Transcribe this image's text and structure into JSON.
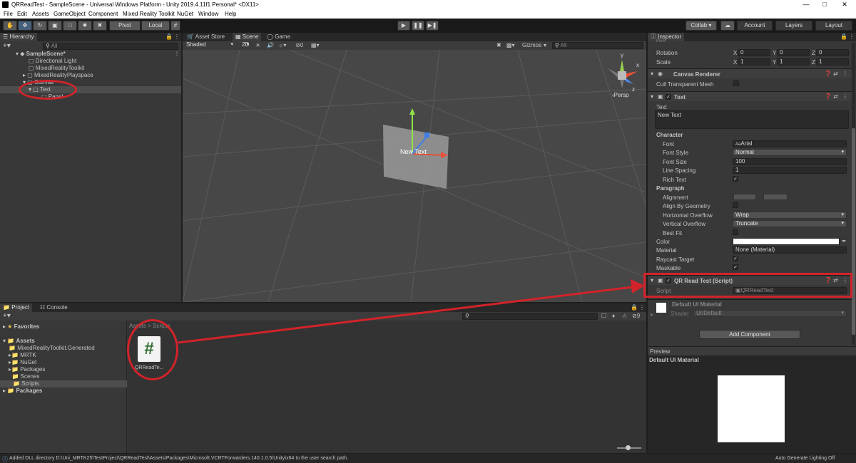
{
  "window": {
    "title": "QRReadTest - SampleScene - Universal Windows Platform - Unity 2019.4.11f1 Personal* <DX11>",
    "min": "—",
    "max": "□",
    "close": "✕"
  },
  "menu": [
    "File",
    "Edit",
    "Assets",
    "GameObject",
    "Component",
    "Mixed Reality Toolkit",
    "NuGet",
    "Window",
    "Help"
  ],
  "toolbar": {
    "pivot": "Pivot",
    "local": "Local",
    "collab": "Collab ▾",
    "account": "Account",
    "layers": "Layers",
    "layout": "Layout"
  },
  "hierarchy": {
    "tab": "Hierarchy",
    "search_placeholder": "All",
    "scene": "SampleScene*",
    "items": [
      {
        "label": "Directional Light"
      },
      {
        "label": "MixedRealityToolkit"
      },
      {
        "label": "MixedRealityPlayspace"
      },
      {
        "label": "Canvas"
      },
      {
        "label": "Text"
      },
      {
        "label": "Panel"
      }
    ]
  },
  "scene": {
    "tabs": [
      "Asset Store",
      "Scene",
      "Game"
    ],
    "shading": "Shaded",
    "mode2d": "2D",
    "fx_count": "0",
    "gizmos": "Gizmos",
    "search_placeholder": "All",
    "persp": "‹Persp",
    "gizmo_y": "y",
    "gizmo_x": "x",
    "gizmo_z": "z",
    "object_text": "New Text"
  },
  "project": {
    "tabs": [
      "Project",
      "Console"
    ],
    "favorites": "Favorites",
    "assets": "Assets",
    "asset_folders": [
      "MixedRealityToolkit.Generated",
      "MRTK",
      "NuGet",
      "Packages",
      "Scenes",
      "Scripts"
    ],
    "packages": "Packages",
    "breadcrumb": "Assets > Scripts",
    "file_name": "QRReadTe...",
    "file_glyph": "#",
    "hidden_count": "9"
  },
  "inspector": {
    "tab": "Inspector",
    "pivot_label": "Pivot",
    "rotation": {
      "label": "Rotation",
      "x": "0",
      "y": "0",
      "z": "0"
    },
    "scale": {
      "label": "Scale",
      "x": "1",
      "y": "1",
      "z": "1"
    },
    "canvas_renderer": "Canvas Renderer",
    "cull": "Cull Transparent Mesh",
    "text_comp": "Text",
    "text_label": "Text",
    "text_value": "New Text",
    "character": "Character",
    "font": {
      "label": "Font",
      "value": "Arial"
    },
    "font_style": {
      "label": "Font Style",
      "value": "Normal"
    },
    "font_size": {
      "label": "Font Size",
      "value": "100"
    },
    "line_spacing": {
      "label": "Line Spacing",
      "value": "1"
    },
    "rich_text": "Rich Text",
    "paragraph": "Paragraph",
    "alignment": "Alignment",
    "align_geom": "Align By Geometry",
    "h_overflow": {
      "label": "Horizontal Overflow",
      "value": "Wrap"
    },
    "v_overflow": {
      "label": "Vertical Overflow",
      "value": "Truncate"
    },
    "best_fit": "Best Fit",
    "color": "Color",
    "material": {
      "label": "Material",
      "value": "None (Material)"
    },
    "raycast": "Raycast Target",
    "maskable": "Maskable",
    "script_comp": "QR Read Test (Script)",
    "script": {
      "label": "Script",
      "value": "QRReadTest"
    },
    "default_material": "Default UI Material",
    "shader": {
      "label": "Shader",
      "value": "UI/Default"
    },
    "add_component": "Add Component",
    "preview": "Preview",
    "preview_title": "Default UI Material"
  },
  "status": {
    "message": "Added DLL directory D:\\Uni_MRTK25\\TestProject\\QRReadTest\\Assets\\Packages\\Microsoft.VCRTForwarders.140.1.0.5\\Unity\\x64 to the user search path.",
    "right": "Auto Generate Lighting Off"
  },
  "colors": {
    "annotation": "#d2232a",
    "selection": "#46607c"
  }
}
